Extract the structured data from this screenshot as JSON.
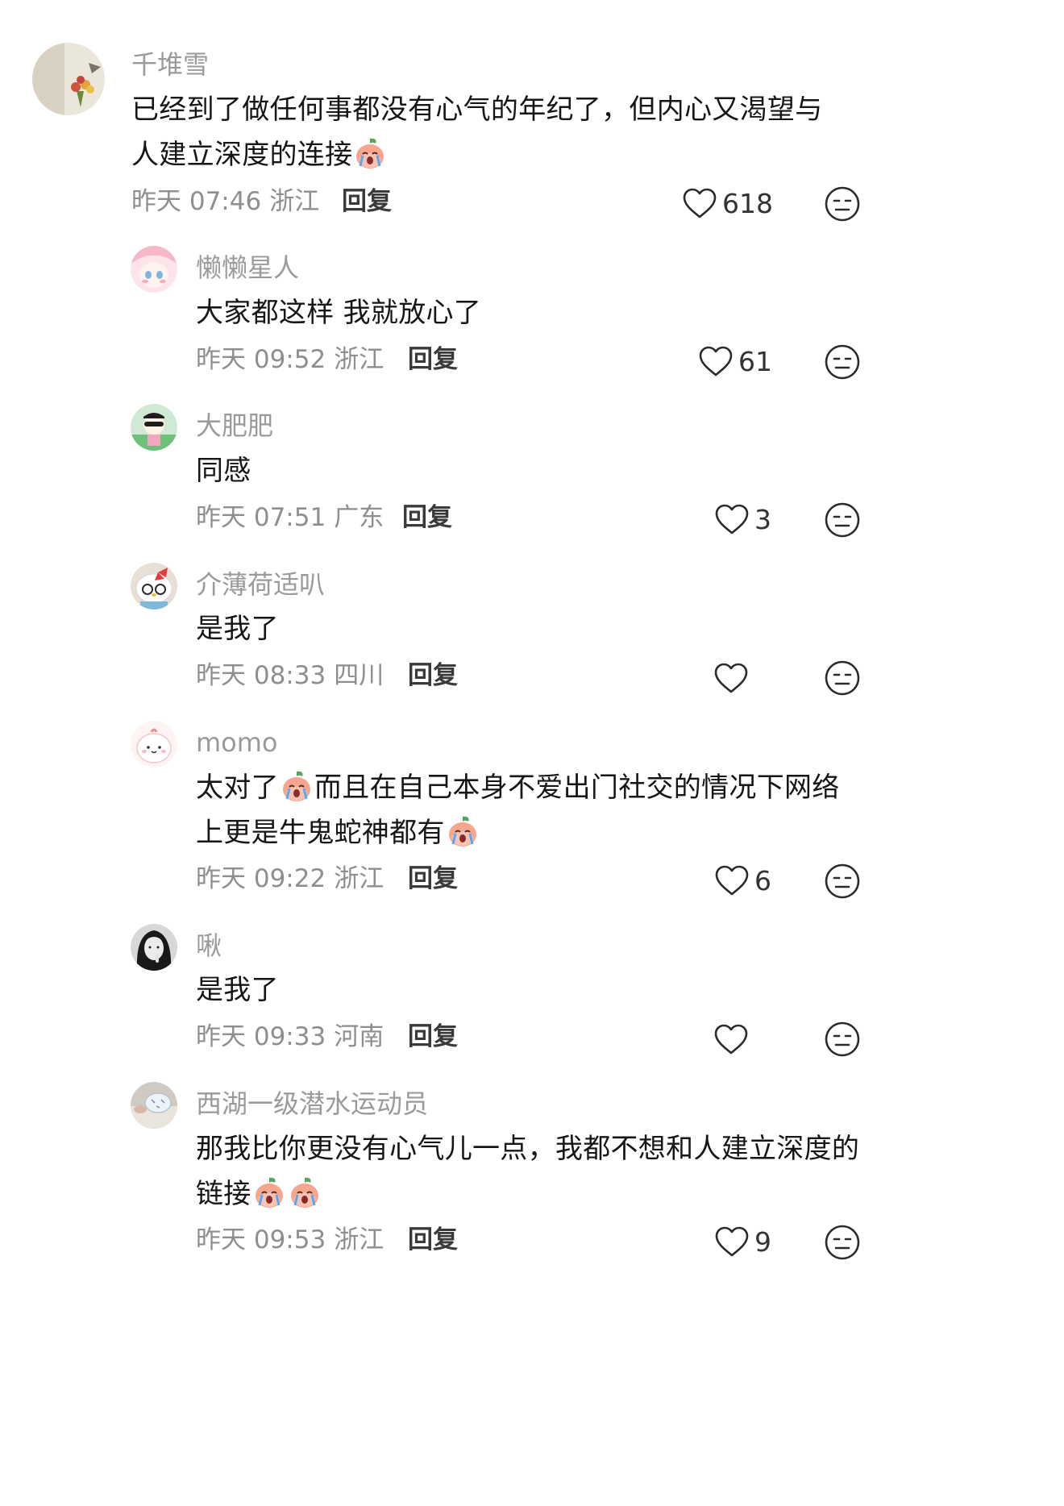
{
  "comments": [
    {
      "author": "千堆雪",
      "text_parts": [
        "已经到了做任何事都没有心气的年纪了，但内心又渴望与人建立深度的连接",
        ""
      ],
      "emoji_count": 1,
      "time": "昨天 07:46",
      "location": "浙江",
      "reply_label": "回复",
      "likes": "618",
      "level": "top"
    },
    {
      "author": "懒懒星人",
      "text_parts": [
        "大家都这样 我就放心了"
      ],
      "emoji_count": 0,
      "time": "昨天 09:52",
      "location": "浙江",
      "reply_label": "回复",
      "likes": "61",
      "level": "reply"
    },
    {
      "author": "大肥肥",
      "text_parts": [
        "同感"
      ],
      "emoji_count": 0,
      "time": "昨天 07:51",
      "location": "广东",
      "reply_label": "回复",
      "likes": "3",
      "level": "reply"
    },
    {
      "author": "介薄荷适叭",
      "text_parts": [
        "是我了"
      ],
      "emoji_count": 0,
      "time": "昨天 08:33",
      "location": "四川",
      "reply_label": "回复",
      "likes": "",
      "level": "reply"
    },
    {
      "author": "momo",
      "text_parts": [
        "太对了",
        "而且在自己本身不爱出门社交的情况下网络上更是牛鬼蛇神都有",
        ""
      ],
      "emoji_count": 2,
      "time": "昨天 09:22",
      "location": "浙江",
      "reply_label": "回复",
      "likes": "6",
      "level": "reply"
    },
    {
      "author": "啾",
      "text_parts": [
        "是我了"
      ],
      "emoji_count": 0,
      "time": "昨天 09:33",
      "location": "河南",
      "reply_label": "回复",
      "likes": "",
      "level": "reply"
    },
    {
      "author": "西湖一级潜水运动员",
      "text_parts": [
        "那我比你更没有心气儿一点，我都不想和人建立深度的链接",
        "",
        ""
      ],
      "emoji_count": 2,
      "time": "昨天 09:53",
      "location": "浙江",
      "reply_label": "回复",
      "likes": "9",
      "level": "reply"
    }
  ],
  "icons": {
    "like": "heart-outline-icon",
    "dislike": "neutral-face-icon",
    "emoji": "crying-peach-emoji"
  },
  "colors": {
    "author": "#9a9a9a",
    "text": "#161616",
    "meta": "#8e8e8e",
    "reply": "#3a3a3a",
    "icon": "#2b2b2b",
    "emoji_skin": "#f8a58f"
  }
}
